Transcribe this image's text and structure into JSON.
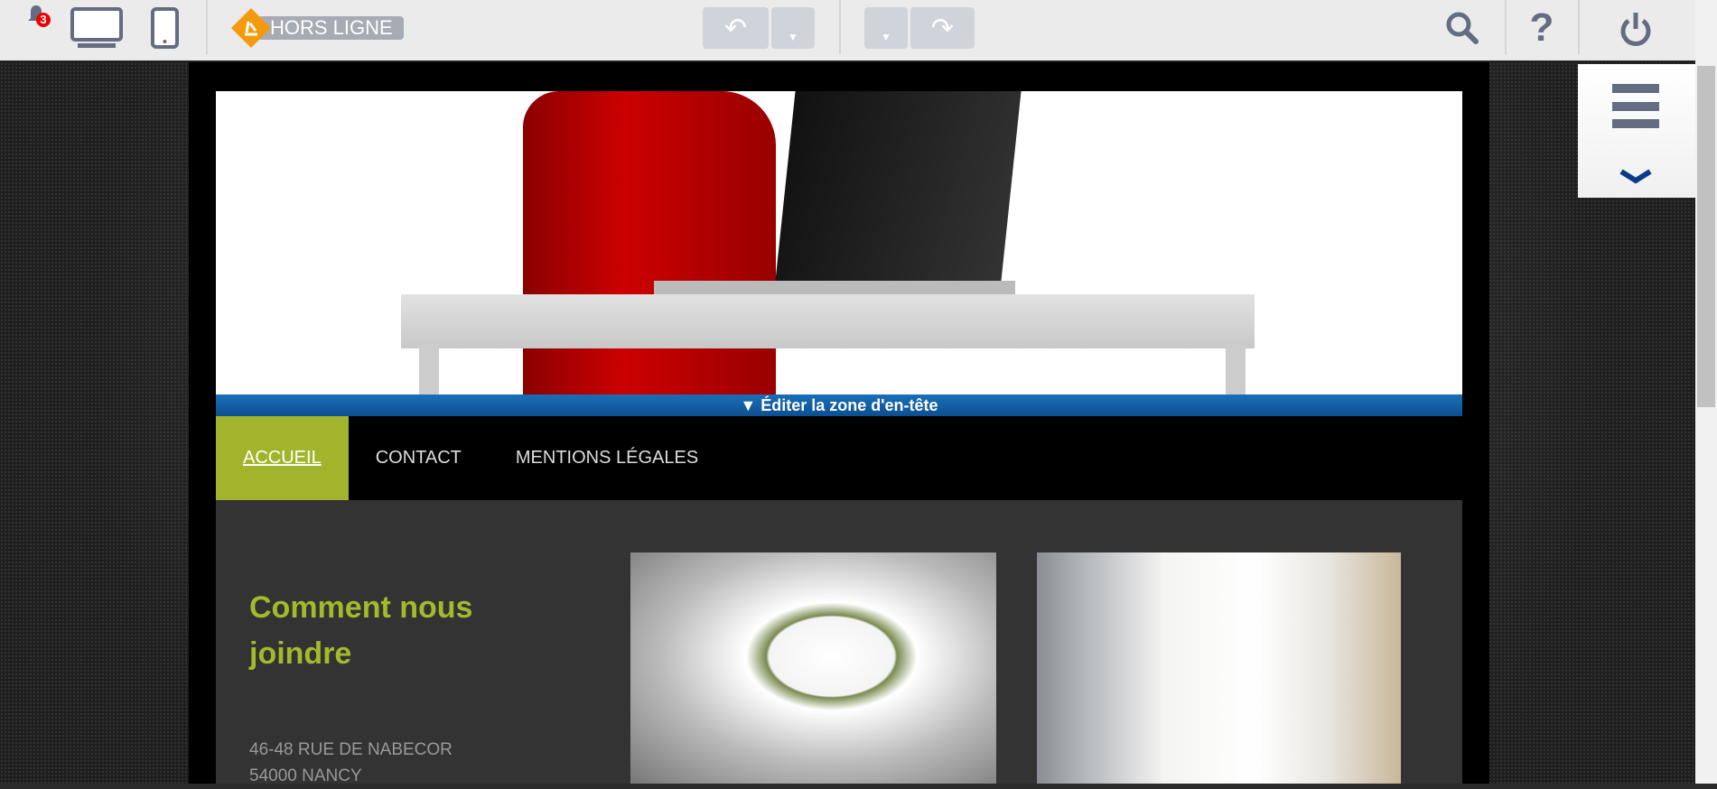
{
  "toolbar": {
    "notification_count": "3",
    "status_label": "HORS LIGNE",
    "icons": [
      "bell-icon",
      "desktop-icon",
      "mobile-icon",
      "offline-worker-icon",
      "undo-icon",
      "redo-icon",
      "search-icon",
      "help-icon",
      "power-icon"
    ]
  },
  "editor": {
    "edit_header_label": "▼ Éditer la zone d'en-tête"
  },
  "nav": {
    "items": [
      {
        "label": "ACCUEIL",
        "active": true
      },
      {
        "label": "CONTACT"
      },
      {
        "label": "MENTIONS LÉGALES"
      }
    ]
  },
  "main": {
    "heading": "Comment nous joindre",
    "address_line1": "46-48 RUE DE NABECOR",
    "address_line2": "54000 NANCY"
  },
  "colors": {
    "accent": "#a4b92c",
    "edit_bar": "#1a6fb8",
    "toolbar": "#ebebeb",
    "icon": "#636c80",
    "offline": "#f59a0c"
  }
}
